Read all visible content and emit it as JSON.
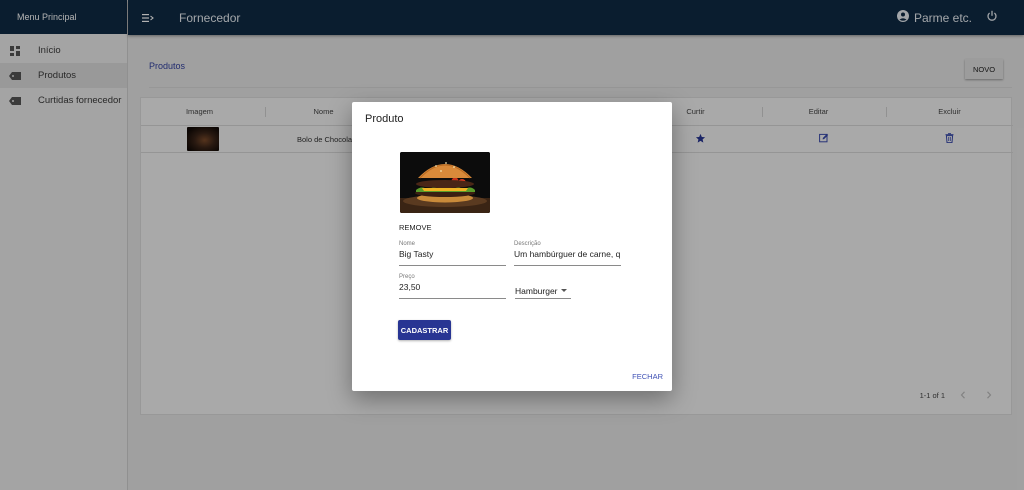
{
  "sidebar": {
    "header": "Menu Principal",
    "items": [
      {
        "label": "Início",
        "icon": "dashboard-icon"
      },
      {
        "label": "Produtos",
        "icon": "label-icon"
      },
      {
        "label": "Curtidas fornecedor",
        "icon": "label-icon"
      }
    ]
  },
  "topbar": {
    "title": "Fornecedor",
    "user": "Parme etc."
  },
  "main": {
    "breadcrumb": "Produtos",
    "novo_label": "NOVO",
    "table": {
      "columns": [
        "Imagem",
        "Nome",
        "Curtir",
        "Editar",
        "Excluir"
      ],
      "rows": [
        {
          "nome": "Bolo de Chocolate"
        }
      ]
    },
    "pager": "1-1 of 1"
  },
  "dialog": {
    "title": "Produto",
    "remove_label": "REMOVE",
    "nome": {
      "label": "Nome",
      "value": "Big Tasty"
    },
    "descricao": {
      "label": "Descrição",
      "value": "Um hambúrguer de carne, q"
    },
    "preco": {
      "label": "Preço",
      "value": "23,50"
    },
    "categoria": "Hamburger",
    "submit_label": "CADASTRAR",
    "close_label": "FECHAR"
  },
  "colors": {
    "topbar": "#0f2a44",
    "primary": "#283593",
    "accent_text": "#3f51b5"
  }
}
